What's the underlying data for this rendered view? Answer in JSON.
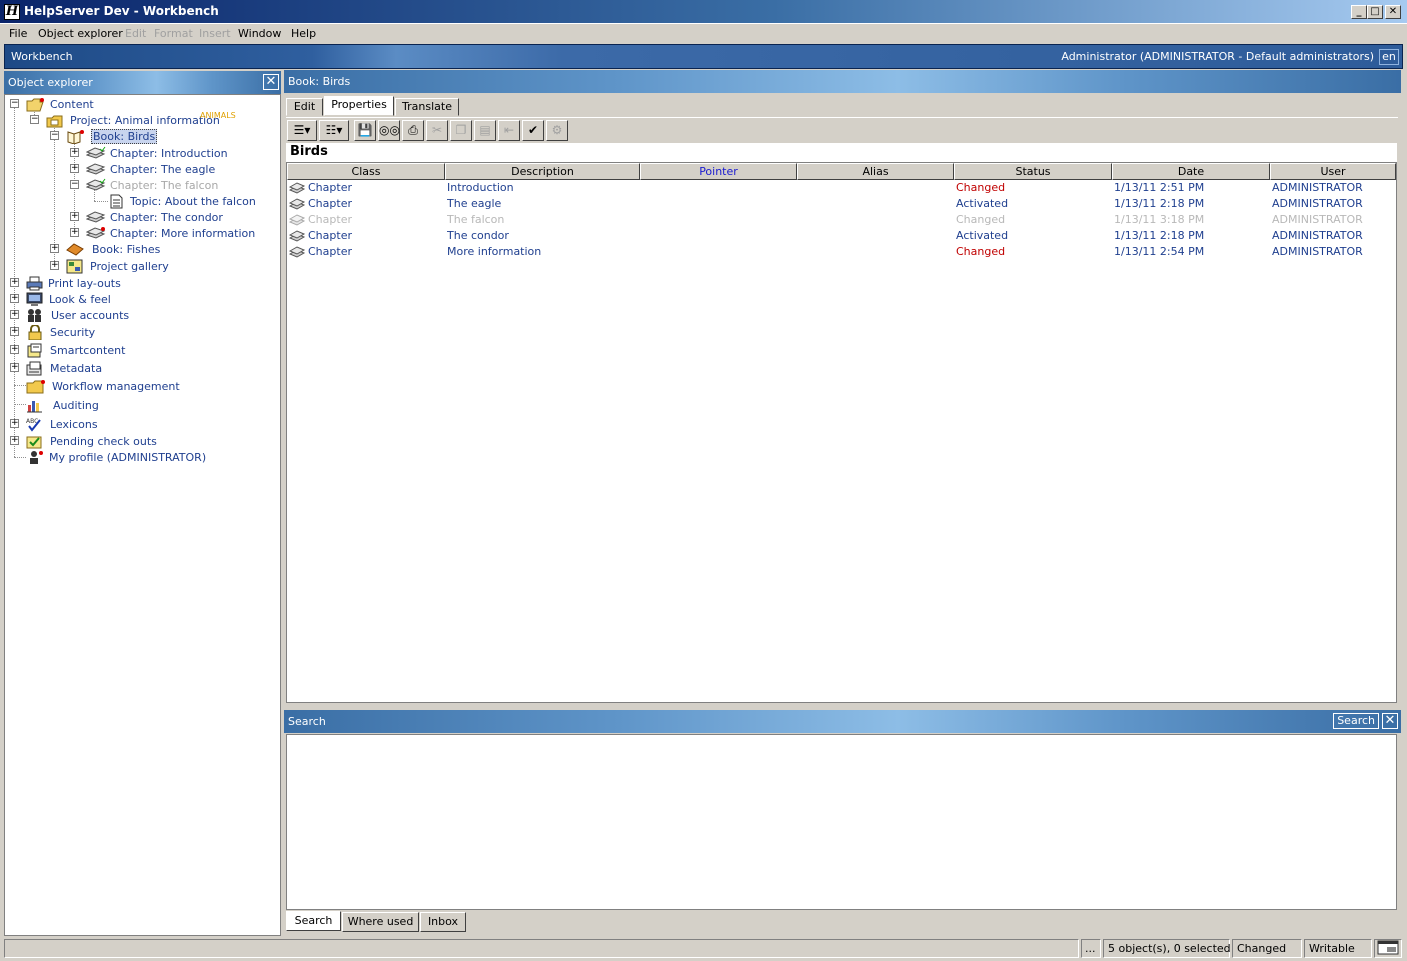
{
  "window": {
    "title": "HelpServer Dev - Workbench",
    "app_icon": "H"
  },
  "menu": [
    {
      "label": "File",
      "enabled": true
    },
    {
      "label": "Object explorer",
      "enabled": true
    },
    {
      "label": "Edit",
      "enabled": false
    },
    {
      "label": "Format",
      "enabled": false
    },
    {
      "label": "Insert",
      "enabled": false
    },
    {
      "label": "Window",
      "enabled": true
    },
    {
      "label": "Help",
      "enabled": true
    }
  ],
  "workbench": {
    "title": "Workbench",
    "user": "Administrator (ADMINISTRATOR - Default administrators)",
    "language": "en"
  },
  "explorer": {
    "title": "Object explorer",
    "tree": [
      {
        "label": "Content",
        "icon": "folder-open-icon"
      },
      {
        "label": "Project: Animal information",
        "icon": "project-folder-icon",
        "tag": "ANIMALS"
      },
      {
        "label": "Book: Birds",
        "icon": "book-open-icon"
      },
      {
        "label": "Chapter: Introduction",
        "icon": "chapter-icon"
      },
      {
        "label": "Chapter: The eagle",
        "icon": "chapter-icon"
      },
      {
        "label": "Chapter: The falcon",
        "icon": "chapter-icon"
      },
      {
        "label": "Topic: About the falcon",
        "icon": "topic-icon"
      },
      {
        "label": "Chapter: The condor",
        "icon": "chapter-icon"
      },
      {
        "label": "Chapter: More information",
        "icon": "chapter-icon"
      },
      {
        "label": "Book: Fishes",
        "icon": "book-icon"
      },
      {
        "label": "Project gallery",
        "icon": "gallery-icon"
      },
      {
        "label": "Print lay-outs",
        "icon": "printer-icon"
      },
      {
        "label": "Look & feel",
        "icon": "monitor-icon"
      },
      {
        "label": "User accounts",
        "icon": "users-icon"
      },
      {
        "label": "Security",
        "icon": "lock-icon"
      },
      {
        "label": "Smartcontent",
        "icon": "smartcontent-icon"
      },
      {
        "label": "Metadata",
        "icon": "metadata-icon"
      },
      {
        "label": "Workflow management",
        "icon": "workflow-icon"
      },
      {
        "label": "Auditing",
        "icon": "chart-icon"
      },
      {
        "label": "Lexicons",
        "icon": "spellcheck-icon"
      },
      {
        "label": "Pending check outs",
        "icon": "checkout-icon"
      },
      {
        "label": "My profile (ADMINISTRATOR)",
        "icon": "user-icon"
      }
    ]
  },
  "content": {
    "header": "Book: Birds",
    "tabs": [
      "Edit",
      "Properties",
      "Translate"
    ],
    "doc_title": "Birds",
    "columns": [
      "Class",
      "Description",
      "Pointer",
      "Alias",
      "Status",
      "Date",
      "User"
    ],
    "rows": [
      {
        "class": "Chapter",
        "description": "Introduction",
        "pointer": "",
        "alias": "",
        "status": "Changed",
        "date": "1/13/11 2:51 PM",
        "user": "ADMINISTRATOR"
      },
      {
        "class": "Chapter",
        "description": "The eagle",
        "pointer": "",
        "alias": "",
        "status": "Activated",
        "date": "1/13/11 2:18 PM",
        "user": "ADMINISTRATOR"
      },
      {
        "class": "Chapter",
        "description": "The falcon",
        "pointer": "",
        "alias": "",
        "status": "Changed",
        "date": "1/13/11 3:18 PM",
        "user": "ADMINISTRATOR"
      },
      {
        "class": "Chapter",
        "description": "The condor",
        "pointer": "",
        "alias": "",
        "status": "Activated",
        "date": "1/13/11 2:18 PM",
        "user": "ADMINISTRATOR"
      },
      {
        "class": "Chapter",
        "description": "More information",
        "pointer": "",
        "alias": "",
        "status": "Changed",
        "date": "1/13/11 2:54 PM",
        "user": "ADMINISTRATOR"
      }
    ]
  },
  "search": {
    "title": "Search",
    "button": "Search",
    "tabs": [
      "Search",
      "Where used",
      "Inbox"
    ]
  },
  "status": {
    "ellipsis": "...",
    "count": "5 object(s), 0 selected",
    "state": "Changed",
    "mode": "Writable"
  }
}
